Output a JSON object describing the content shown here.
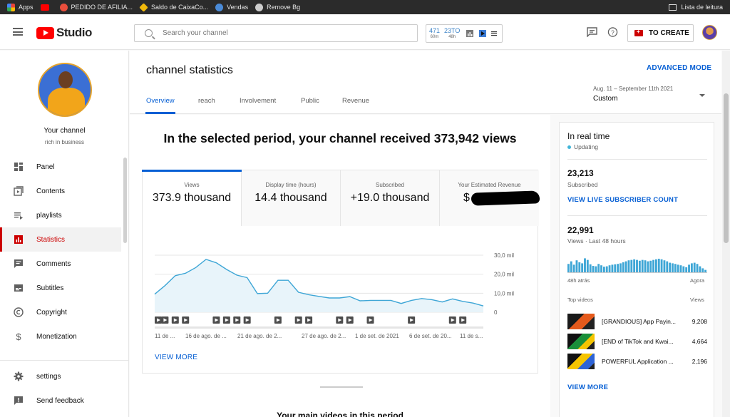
{
  "bookmarks": [
    {
      "label": "Apps",
      "icon": "apps-grid-icon",
      "color": "#ea4335"
    },
    {
      "label": "",
      "icon": "youtube-icon",
      "color": "#ff0000"
    },
    {
      "label": "PEDIDO DE AFILIA...",
      "icon": "hotmart-icon",
      "color": "#e94e3c"
    },
    {
      "label": "Saldo de CaixaCo...",
      "icon": "binance-icon",
      "color": "#f0b90b"
    },
    {
      "label": "Vendas",
      "icon": "hotmart-sales-icon",
      "color": "#4a8bd8"
    },
    {
      "label": "Remove Bg",
      "icon": "remove-bg-icon",
      "color": "#cccccc"
    }
  ],
  "reading_list": "Lista de leitura",
  "header": {
    "logo_text": "Studio",
    "search_placeholder": "Search your channel",
    "widget": {
      "stat1_value": "471",
      "stat1_label": "60m",
      "stat2_value": "23TO",
      "stat2_label": "48h"
    },
    "create_label": "TO CREATE"
  },
  "sidebar": {
    "channel_name": "Your channel",
    "channel_sub": "rich in business",
    "items": [
      {
        "label": "Panel",
        "icon": "dashboard-icon"
      },
      {
        "label": "Contents",
        "icon": "content-icon"
      },
      {
        "label": "playlists",
        "icon": "playlist-icon"
      },
      {
        "label": "Statistics",
        "icon": "analytics-icon"
      },
      {
        "label": "Comments",
        "icon": "comments-icon"
      },
      {
        "label": "Subtitles",
        "icon": "subtitles-icon"
      },
      {
        "label": "Copyright",
        "icon": "copyright-icon"
      },
      {
        "label": "Monetization",
        "icon": "dollar-icon"
      }
    ],
    "bottom_items": [
      {
        "label": "settings",
        "icon": "gear-icon"
      },
      {
        "label": "Send feedback",
        "icon": "feedback-icon"
      }
    ]
  },
  "page": {
    "title": "channel statistics",
    "advanced_mode": "ADVANCED MODE",
    "tabs": [
      "Overview",
      "reach",
      "Involvement",
      "Public",
      "Revenue"
    ],
    "date_range": "Aug. 11 – September 11th 2021",
    "date_mode": "Custom",
    "headline": "In the selected period, your channel received 373,942 views",
    "metrics": [
      {
        "label": "Views",
        "value": "373.9 thousand"
      },
      {
        "label": "Display time (hours)",
        "value": "14.4 thousand"
      },
      {
        "label": "Subscribed",
        "value": "+19.0 thousand"
      },
      {
        "label": "Your Estimated Revenue",
        "value": "$"
      }
    ],
    "view_more": "VIEW MORE",
    "bottom_title": "Your main videos in this period"
  },
  "chart_data": {
    "type": "area",
    "x": [
      "11 de ...",
      "16 de ago. de ...",
      "21 de ago. de 2...",
      "27 de ago. de 2...",
      "1 de set. de 2021",
      "6 de set. de 20...",
      "11 de s..."
    ],
    "y_ticks": [
      "30,0 mil",
      "20,0 mil",
      "10,0 mil",
      "0"
    ],
    "ylim": [
      0,
      30000
    ],
    "values": [
      9500,
      14000,
      19200,
      20500,
      23500,
      27800,
      26000,
      22500,
      19500,
      18200,
      9800,
      10000,
      16800,
      16800,
      10500,
      9200,
      8300,
      7500,
      7500,
      8200,
      6000,
      6200,
      6200,
      6200,
      4600,
      6200,
      7200,
      6600,
      5400,
      7000,
      5700,
      4800,
      3300
    ],
    "video_marker_indices": [
      0,
      1,
      2,
      3,
      6,
      7,
      8,
      9,
      12,
      14,
      15,
      18,
      19,
      21,
      25,
      29,
      30
    ],
    "line_color": "#3ea6d6",
    "fill_color": "#e8f4fa"
  },
  "realtime": {
    "title": "In real time",
    "status": "Updating",
    "subscribers": "23,213",
    "subscribers_label": "Subscribed",
    "live_link": "VIEW LIVE SUBSCRIBER COUNT",
    "views": "22,991",
    "views_label": "Views · Last 48 hours",
    "axis_left": "48h atrás",
    "axis_right": "Agora",
    "top_videos_label": "Top videos",
    "views_col_label": "Views",
    "bars": [
      0.42,
      0.55,
      0.38,
      0.6,
      0.5,
      0.45,
      0.7,
      0.62,
      0.4,
      0.32,
      0.3,
      0.42,
      0.35,
      0.28,
      0.3,
      0.35,
      0.38,
      0.4,
      0.42,
      0.45,
      0.5,
      0.55,
      0.6,
      0.62,
      0.65,
      0.62,
      0.58,
      0.62,
      0.6,
      0.55,
      0.58,
      0.62,
      0.65,
      0.68,
      0.65,
      0.6,
      0.55,
      0.48,
      0.45,
      0.42,
      0.38,
      0.35,
      0.3,
      0.25,
      0.38,
      0.45,
      0.48,
      0.42,
      0.3,
      0.2,
      0.12
    ],
    "bar_color": "#3ea6d6",
    "top_videos": [
      {
        "title": "[GRANDIOUS] App Payin...",
        "views": "9,208"
      },
      {
        "title": "[END of TikTok and Kwai...",
        "views": "4,664"
      },
      {
        "title": "POWERFUL Application ...",
        "views": "2,196"
      }
    ],
    "view_more": "VIEW MORE"
  }
}
